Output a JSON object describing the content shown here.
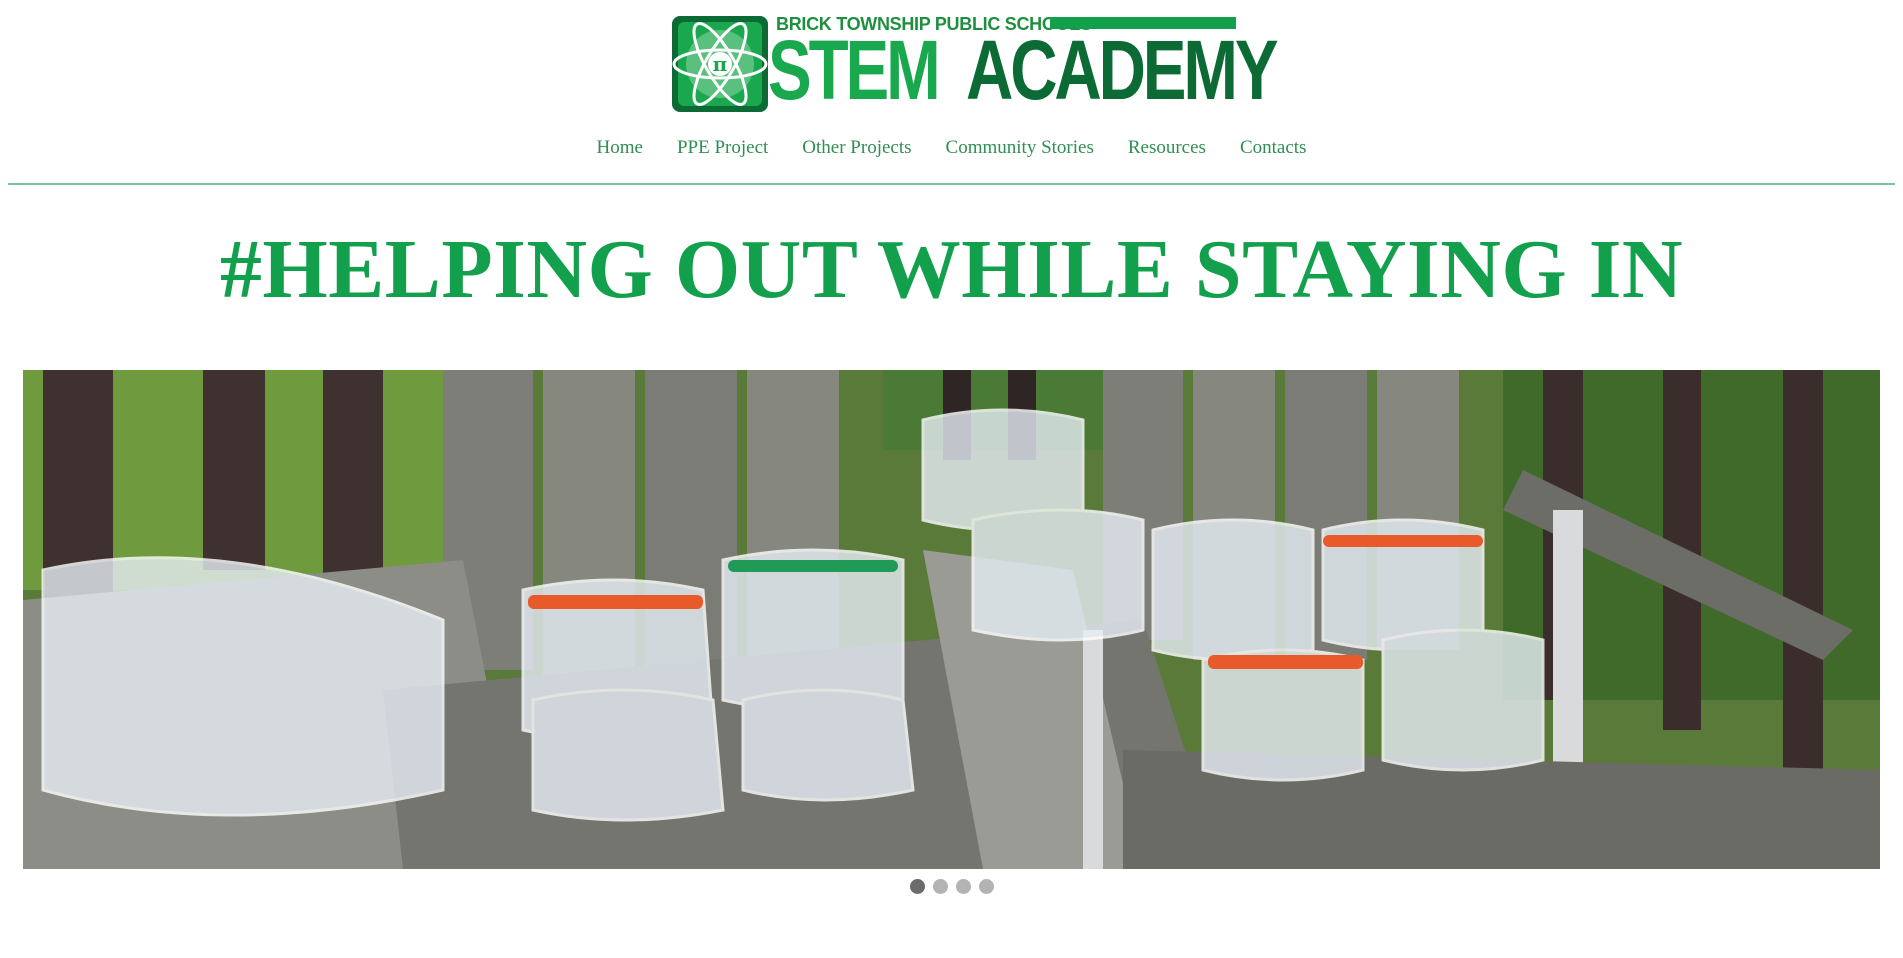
{
  "logo": {
    "subtitle": "BRICK TOWNSHIP PUBLIC SCHOOLS",
    "word1": "STEM",
    "word2": "ACADEMY",
    "emblem_symbol": "π",
    "emblem_icon": "atom-icon",
    "colors": {
      "light_green": "#1aa84e",
      "dark_green": "#0c6b35"
    }
  },
  "nav": {
    "items": [
      {
        "label": "Home"
      },
      {
        "label": "PPE Project"
      },
      {
        "label": "Other Projects"
      },
      {
        "label": "Community Stories"
      },
      {
        "label": "Resources"
      },
      {
        "label": "Contacts"
      }
    ],
    "color": "#2f8e52"
  },
  "headline": "#HELPING OUT WHILE STAYING IN",
  "slider": {
    "slide_count": 4,
    "active_slide": 1
  },
  "colors": {
    "accent": "#12a04d",
    "rule": "#7ec3a1"
  }
}
